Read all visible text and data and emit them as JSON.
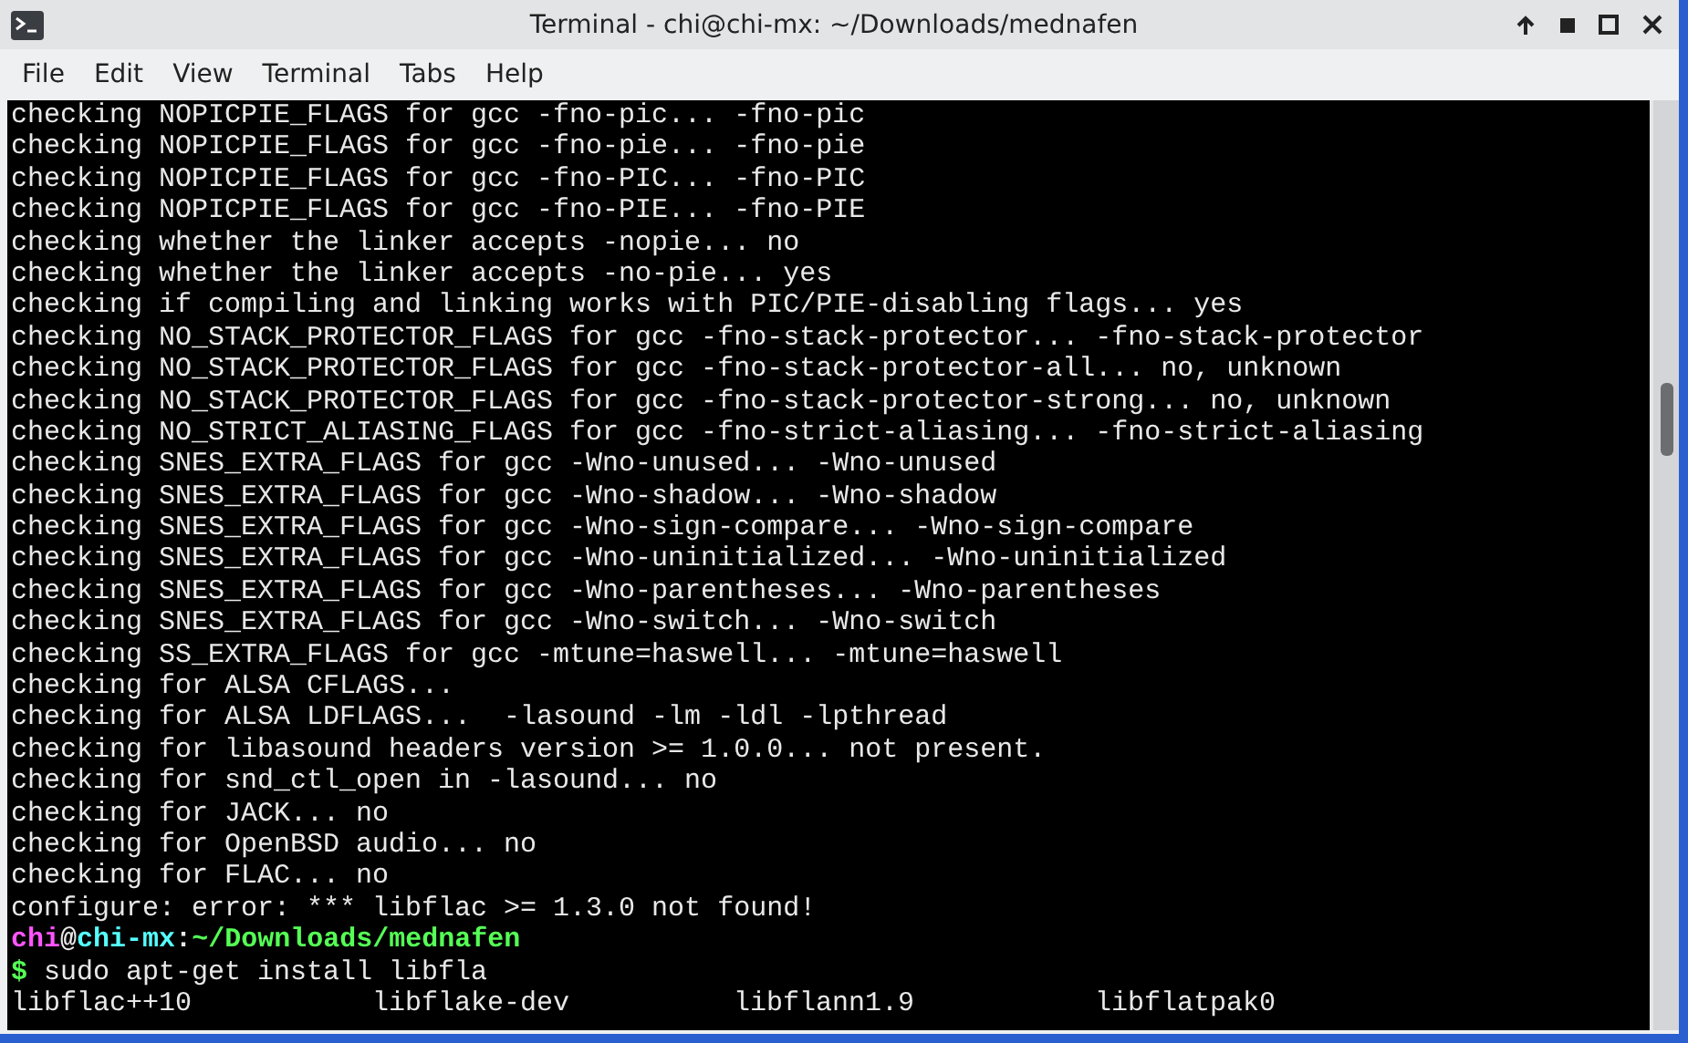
{
  "window": {
    "title": "Terminal - chi@chi-mx: ~/Downloads/mednafen"
  },
  "menu": [
    "File",
    "Edit",
    "View",
    "Terminal",
    "Tabs",
    "Help"
  ],
  "terminal": {
    "lines": [
      {
        "kind": "output",
        "text": "checking NOPICPIE_FLAGS for gcc -fno-pic... -fno-pic"
      },
      {
        "kind": "output",
        "text": "checking NOPICPIE_FLAGS for gcc -fno-pie... -fno-pie"
      },
      {
        "kind": "output",
        "text": "checking NOPICPIE_FLAGS for gcc -fno-PIC... -fno-PIC"
      },
      {
        "kind": "output",
        "text": "checking NOPICPIE_FLAGS for gcc -fno-PIE... -fno-PIE"
      },
      {
        "kind": "output",
        "text": "checking whether the linker accepts -nopie... no"
      },
      {
        "kind": "output",
        "text": "checking whether the linker accepts -no-pie... yes"
      },
      {
        "kind": "output",
        "text": "checking if compiling and linking works with PIC/PIE-disabling flags... yes"
      },
      {
        "kind": "output",
        "text": "checking NO_STACK_PROTECTOR_FLAGS for gcc -fno-stack-protector... -fno-stack-protector"
      },
      {
        "kind": "output",
        "text": "checking NO_STACK_PROTECTOR_FLAGS for gcc -fno-stack-protector-all... no, unknown"
      },
      {
        "kind": "output",
        "text": "checking NO_STACK_PROTECTOR_FLAGS for gcc -fno-stack-protector-strong... no, unknown"
      },
      {
        "kind": "output",
        "text": "checking NO_STRICT_ALIASING_FLAGS for gcc -fno-strict-aliasing... -fno-strict-aliasing"
      },
      {
        "kind": "output",
        "text": "checking SNES_EXTRA_FLAGS for gcc -Wno-unused... -Wno-unused"
      },
      {
        "kind": "output",
        "text": "checking SNES_EXTRA_FLAGS for gcc -Wno-shadow... -Wno-shadow"
      },
      {
        "kind": "output",
        "text": "checking SNES_EXTRA_FLAGS for gcc -Wno-sign-compare... -Wno-sign-compare"
      },
      {
        "kind": "output",
        "text": "checking SNES_EXTRA_FLAGS for gcc -Wno-uninitialized... -Wno-uninitialized"
      },
      {
        "kind": "output",
        "text": "checking SNES_EXTRA_FLAGS for gcc -Wno-parentheses... -Wno-parentheses"
      },
      {
        "kind": "output",
        "text": "checking SNES_EXTRA_FLAGS for gcc -Wno-switch... -Wno-switch"
      },
      {
        "kind": "output",
        "text": "checking SS_EXTRA_FLAGS for gcc -mtune=haswell... -mtune=haswell"
      },
      {
        "kind": "output",
        "text": "checking for ALSA CFLAGS..."
      },
      {
        "kind": "output",
        "text": "checking for ALSA LDFLAGS...  -lasound -lm -ldl -lpthread"
      },
      {
        "kind": "output",
        "text": "checking for libasound headers version >= 1.0.0... not present."
      },
      {
        "kind": "output",
        "text": "checking for snd_ctl_open in -lasound... no"
      },
      {
        "kind": "output",
        "text": "checking for JACK... no"
      },
      {
        "kind": "output",
        "text": "checking for OpenBSD audio... no"
      },
      {
        "kind": "output",
        "text": "checking for FLAC... no"
      },
      {
        "kind": "output",
        "text": "configure: error: *** libflac >= 1.3.0 not found!"
      },
      {
        "kind": "prompt",
        "segments": [
          {
            "text": "chi",
            "color": "#ff55ff"
          },
          {
            "text": "@",
            "color": "#e8e8e8"
          },
          {
            "text": "chi-mx",
            "color": "#55ffff"
          },
          {
            "text": ":",
            "color": "#e8e8e8"
          },
          {
            "text": "~/Downloads/mednafen",
            "color": "#55ff55"
          }
        ]
      },
      {
        "kind": "command",
        "symbol": "$",
        "text": "sudo apt-get install libfla"
      },
      {
        "kind": "columns",
        "columns": [
          "libflac++10",
          "libflake-dev",
          "libflann1.9",
          "libflatpak0"
        ]
      }
    ]
  }
}
